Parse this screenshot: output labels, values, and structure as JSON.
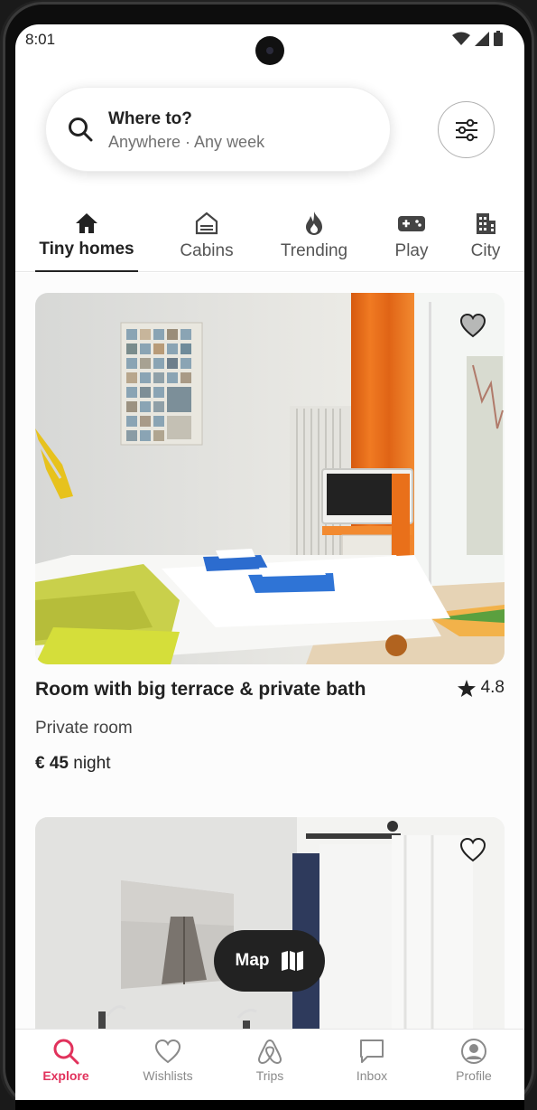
{
  "status_bar": {
    "time": "8:01"
  },
  "search": {
    "title": "Where to?",
    "subtitle": "Anywhere · Any week"
  },
  "categories": [
    {
      "label": "Tiny homes",
      "icon": "home-icon",
      "active": true
    },
    {
      "label": "Cabins",
      "icon": "cabin-icon",
      "active": false
    },
    {
      "label": "Trending",
      "icon": "fire-icon",
      "active": false
    },
    {
      "label": "Play",
      "icon": "gamepad-icon",
      "active": false
    },
    {
      "label": "City",
      "icon": "city-icon",
      "active": false
    }
  ],
  "listings": [
    {
      "title": "Room with big terrace & private bath",
      "rating": "4.8",
      "type": "Private room",
      "price": "€ 45",
      "price_unit": "night",
      "favorited": false
    },
    {
      "favorited": false
    }
  ],
  "map_button": {
    "label": "Map"
  },
  "tab_bar": [
    {
      "label": "Explore",
      "icon": "search-icon",
      "active": true
    },
    {
      "label": "Wishlists",
      "icon": "heart-icon",
      "active": false
    },
    {
      "label": "Trips",
      "icon": "airbnb-logo-icon",
      "active": false
    },
    {
      "label": "Inbox",
      "icon": "message-icon",
      "active": false
    },
    {
      "label": "Profile",
      "icon": "profile-icon",
      "active": false
    }
  ],
  "colors": {
    "accent": "#e1325c",
    "text": "#222222",
    "muted": "#717171"
  }
}
